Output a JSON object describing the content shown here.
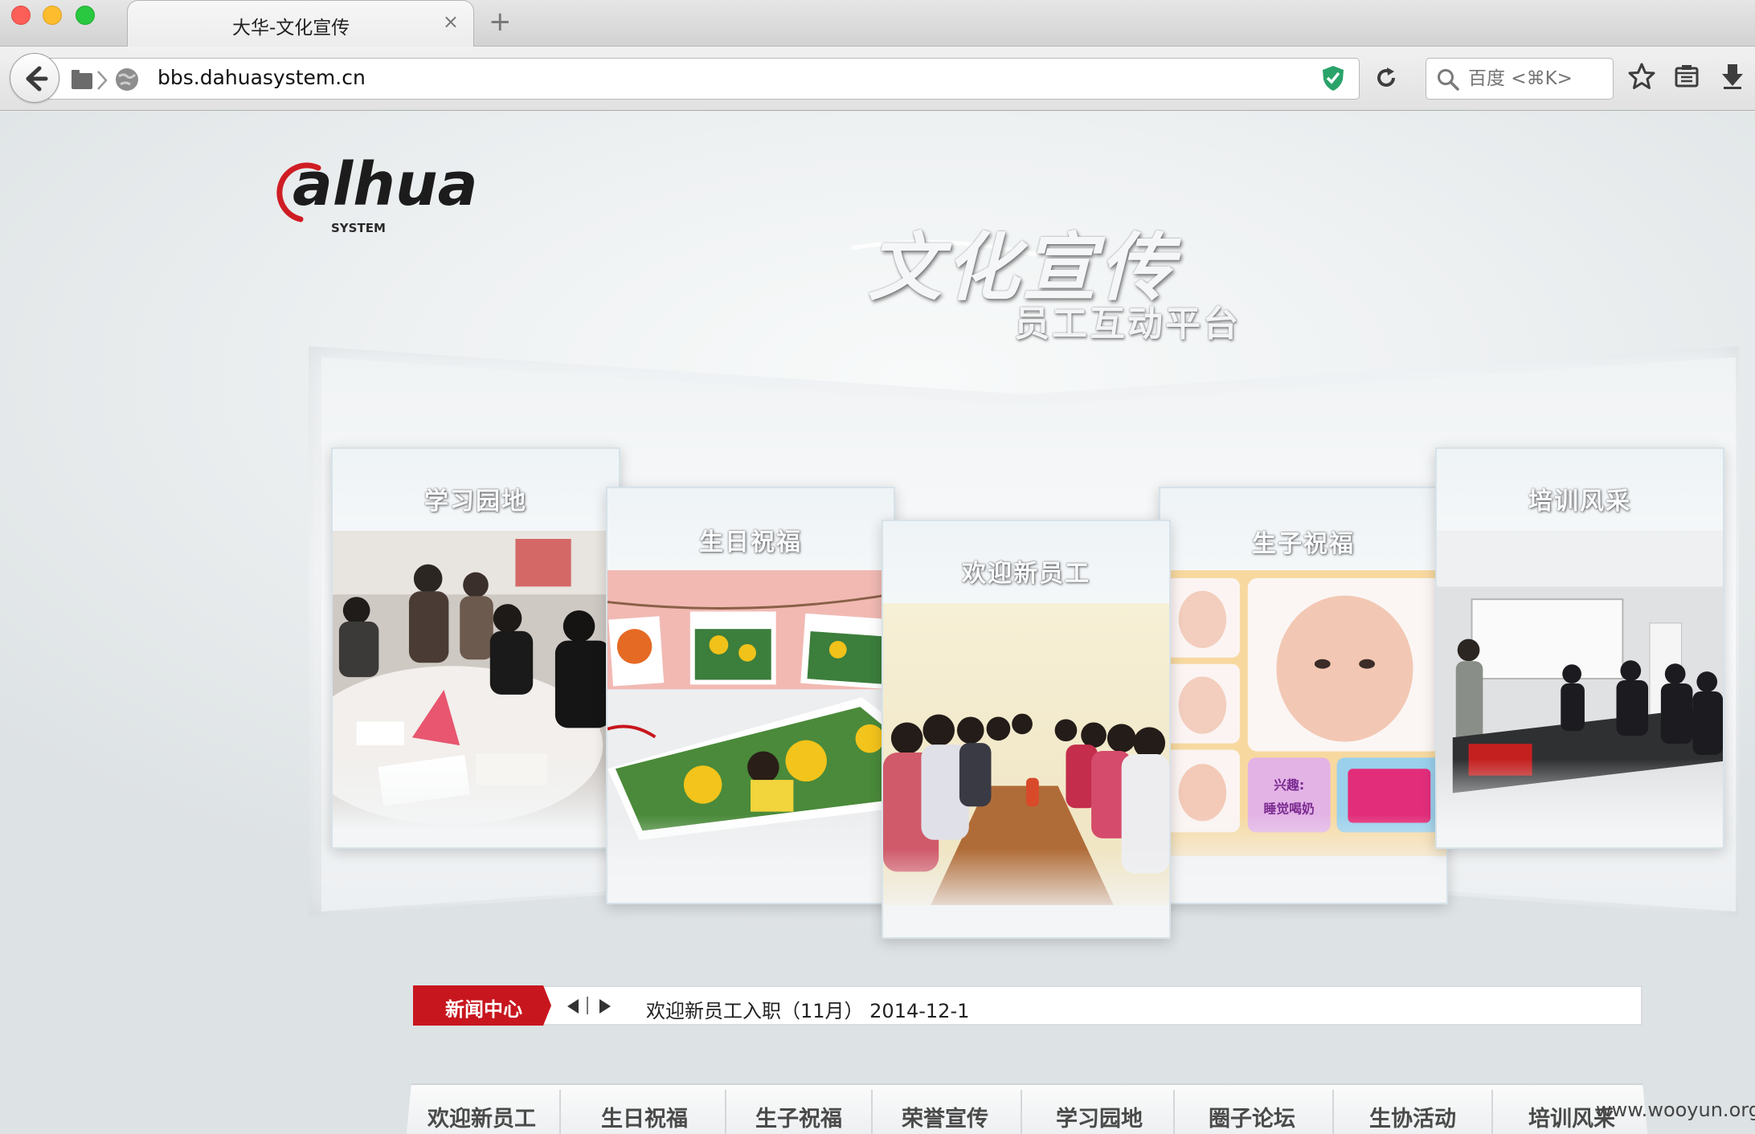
{
  "browser": {
    "tab_title": "大华-文化宣传",
    "tab_close": "×",
    "new_tab": "+",
    "url": "bbs.dahuasystem.cn",
    "search_placeholder": "百度 <⌘K>"
  },
  "page": {
    "logo_text": "alhua",
    "logo_sub": "SYSTEM",
    "hero_title": "文化宣传",
    "hero_subtitle": "员工互动平台",
    "cards": [
      {
        "label": "学习园地"
      },
      {
        "label": "生日祝福"
      },
      {
        "label": "欢迎新员工"
      },
      {
        "label": "生子祝福"
      },
      {
        "label": "培训风采"
      }
    ],
    "baby_sign": "兴趣:\n睡觉喝奶",
    "news": {
      "tag": "新闻中心",
      "headline": "欢迎新员工入职（11月） 2014-12-1"
    },
    "nav_items": [
      "欢迎新员工",
      "生日祝福",
      "生子祝福",
      "荣誉宣传",
      "学习园地",
      "圈子论坛",
      "生协活动",
      "培训风采"
    ],
    "watermark": "www.wooyun.org"
  },
  "colors": {
    "brand_red": "#c8161e",
    "text_dark": "#4a4a4a"
  }
}
